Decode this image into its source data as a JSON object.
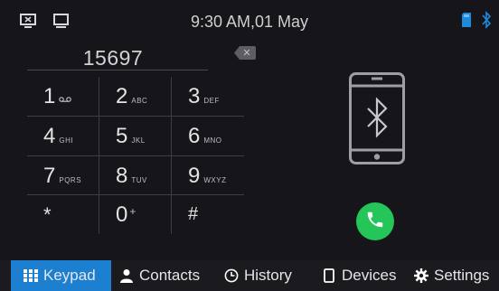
{
  "status": {
    "time": "9:30 AM,01 May"
  },
  "dialer": {
    "number": "15697",
    "delete_glyph": "✕",
    "keys": [
      {
        "digit": "1",
        "letters": "oo"
      },
      {
        "digit": "2",
        "letters": "ABC"
      },
      {
        "digit": "3",
        "letters": "DEF"
      },
      {
        "digit": "4",
        "letters": "GHI"
      },
      {
        "digit": "5",
        "letters": "JKL"
      },
      {
        "digit": "6",
        "letters": "MNO"
      },
      {
        "digit": "7",
        "letters": "PQRS"
      },
      {
        "digit": "8",
        "letters": "TUV"
      },
      {
        "digit": "9",
        "letters": "WXYZ"
      },
      {
        "digit": "*",
        "letters": ""
      },
      {
        "digit": "0",
        "letters": "+"
      },
      {
        "digit": "#",
        "letters": ""
      }
    ]
  },
  "tabs": [
    {
      "label": "Keypad",
      "icon": "grid-icon"
    },
    {
      "label": "Contacts",
      "icon": "person-icon"
    },
    {
      "label": "History",
      "icon": "clock-icon"
    },
    {
      "label": "Devices",
      "icon": "phone-icon"
    },
    {
      "label": "Settings",
      "icon": "gear-icon"
    }
  ],
  "colors": {
    "accent": "#1c7fd0",
    "call": "#24c65a",
    "background": "#16161a"
  }
}
